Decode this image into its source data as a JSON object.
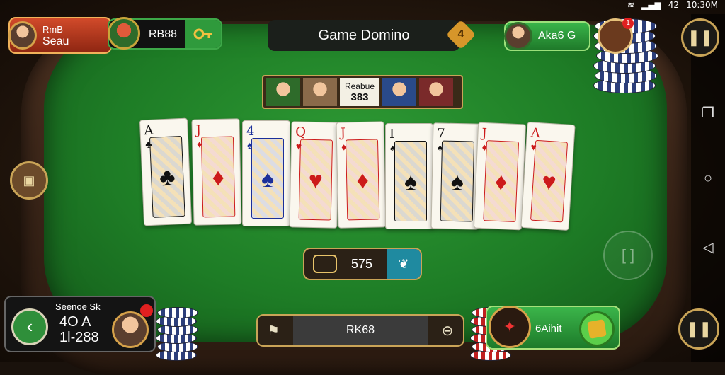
{
  "status_bar": {
    "battery": "42",
    "time": "10:30M"
  },
  "header": {
    "title": "Game Domino",
    "title_badge": "4"
  },
  "players": {
    "p1": {
      "line1": "RmB",
      "line2": "Seau"
    },
    "p2": {
      "score": "RB88"
    },
    "p3": {
      "label": "Aka6 G"
    },
    "p4": {
      "name": "Seenoe Sk",
      "line1": "4O A",
      "line2": "1l-288"
    },
    "p5": {
      "label": "6Aihit"
    }
  },
  "score_strip": {
    "label": "Reabue",
    "value": "383"
  },
  "cards": [
    {
      "rank": "A",
      "suit": "club",
      "color": "#111111"
    },
    {
      "rank": "J",
      "suit": "diamond",
      "color": "#cc1a1a"
    },
    {
      "rank": "4",
      "suit": "spade",
      "color": "#1b2f9a"
    },
    {
      "rank": "Q",
      "suit": "heart",
      "color": "#cc1a1a"
    },
    {
      "rank": "J",
      "suit": "diamond",
      "color": "#cc1a1a"
    },
    {
      "rank": "I",
      "suit": "spade",
      "color": "#111111"
    },
    {
      "rank": "7",
      "suit": "spade",
      "color": "#111111"
    },
    {
      "rank": "J",
      "suit": "diamond",
      "color": "#cc1a1a"
    },
    {
      "rank": "A",
      "suit": "heart",
      "color": "#cc1a1a"
    }
  ],
  "bet": {
    "amount": "575"
  },
  "bottom_bar": {
    "value": "RK68"
  },
  "icons": {
    "notification_count": "1"
  }
}
